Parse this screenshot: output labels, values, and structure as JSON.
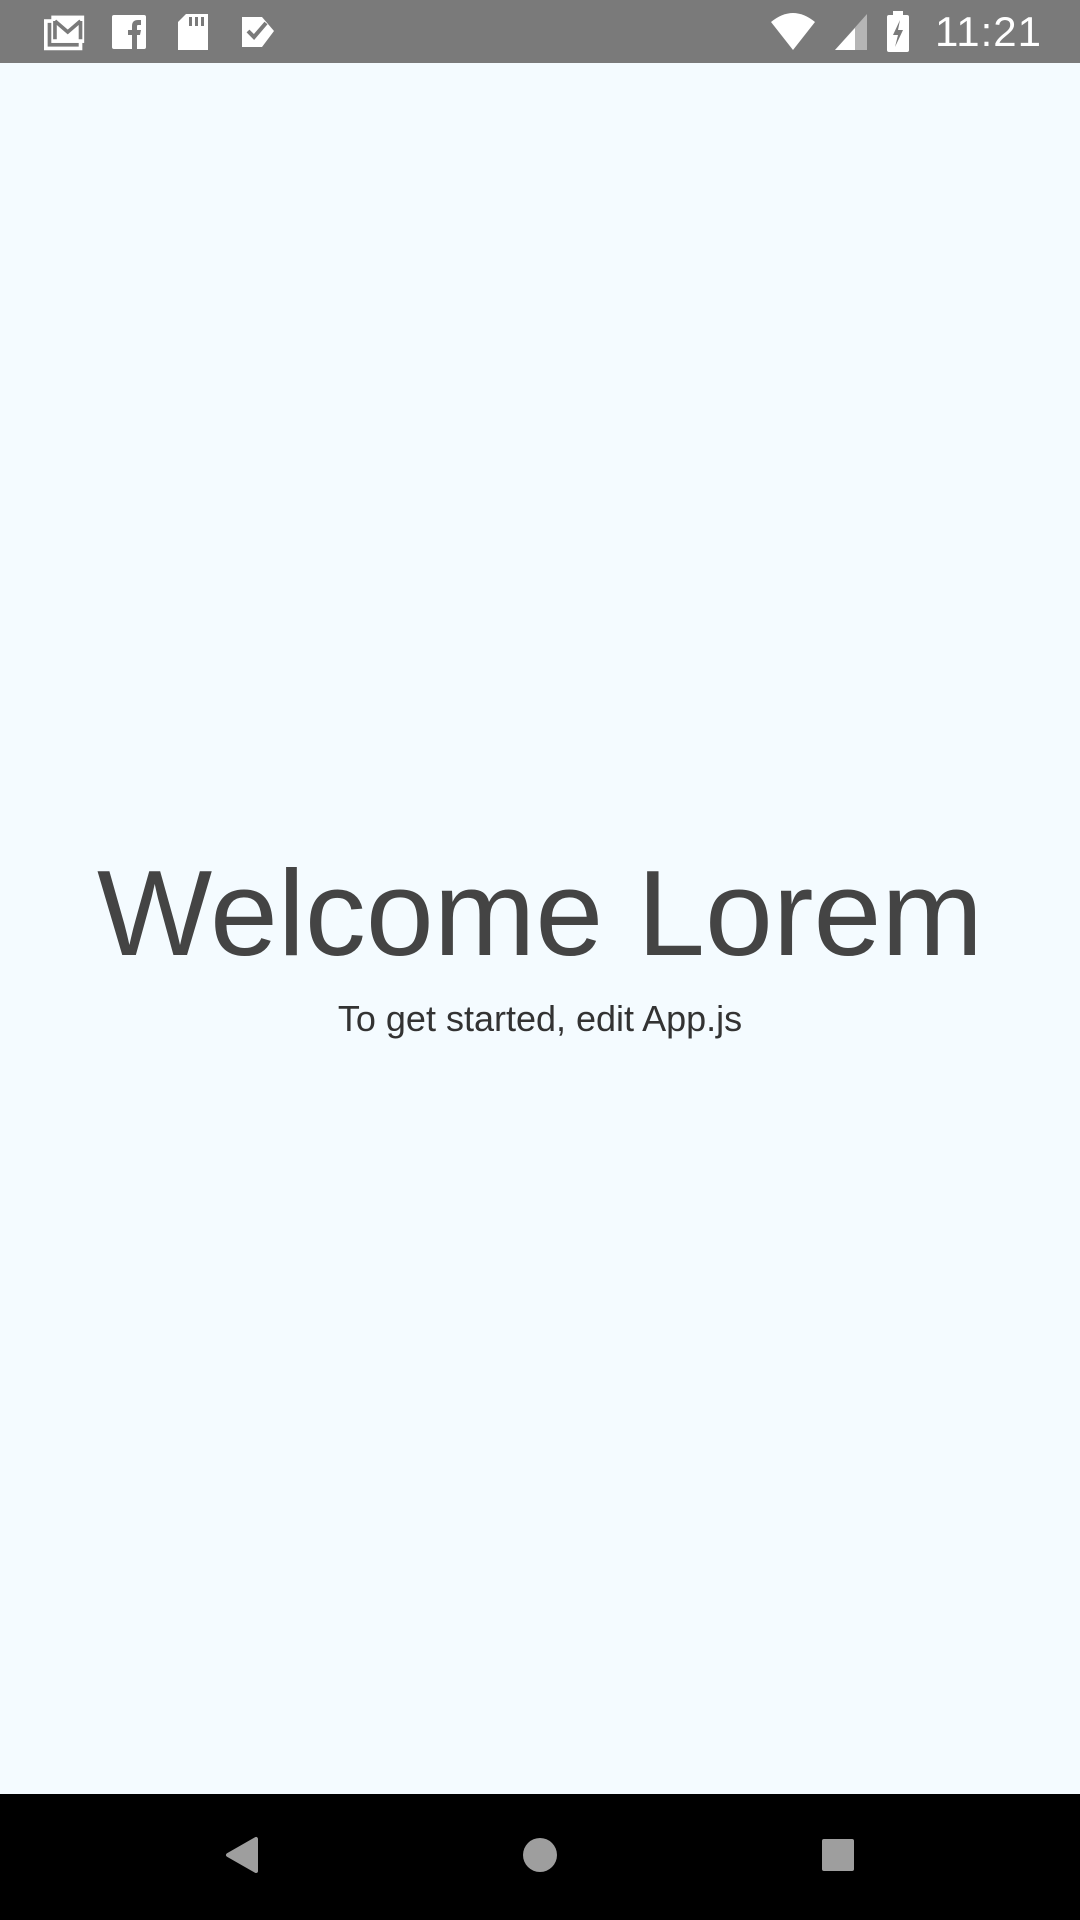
{
  "status_bar": {
    "time": "11:21",
    "notification_icons": [
      "gmail-icon",
      "facebook-icon",
      "sd-card-icon",
      "task-check-icon"
    ],
    "system_icons": [
      "wifi-icon",
      "cell-signal-icon",
      "battery-charging-icon"
    ],
    "background_color": "#7A7A7A"
  },
  "main": {
    "title": "Welcome Lorem",
    "instructions": "To get started, edit App.js",
    "background_color": "#F4FBFF",
    "title_color": "#444444"
  },
  "nav_bar": {
    "buttons": [
      "back-icon",
      "home-icon",
      "recents-icon"
    ],
    "background_color": "#000000"
  }
}
